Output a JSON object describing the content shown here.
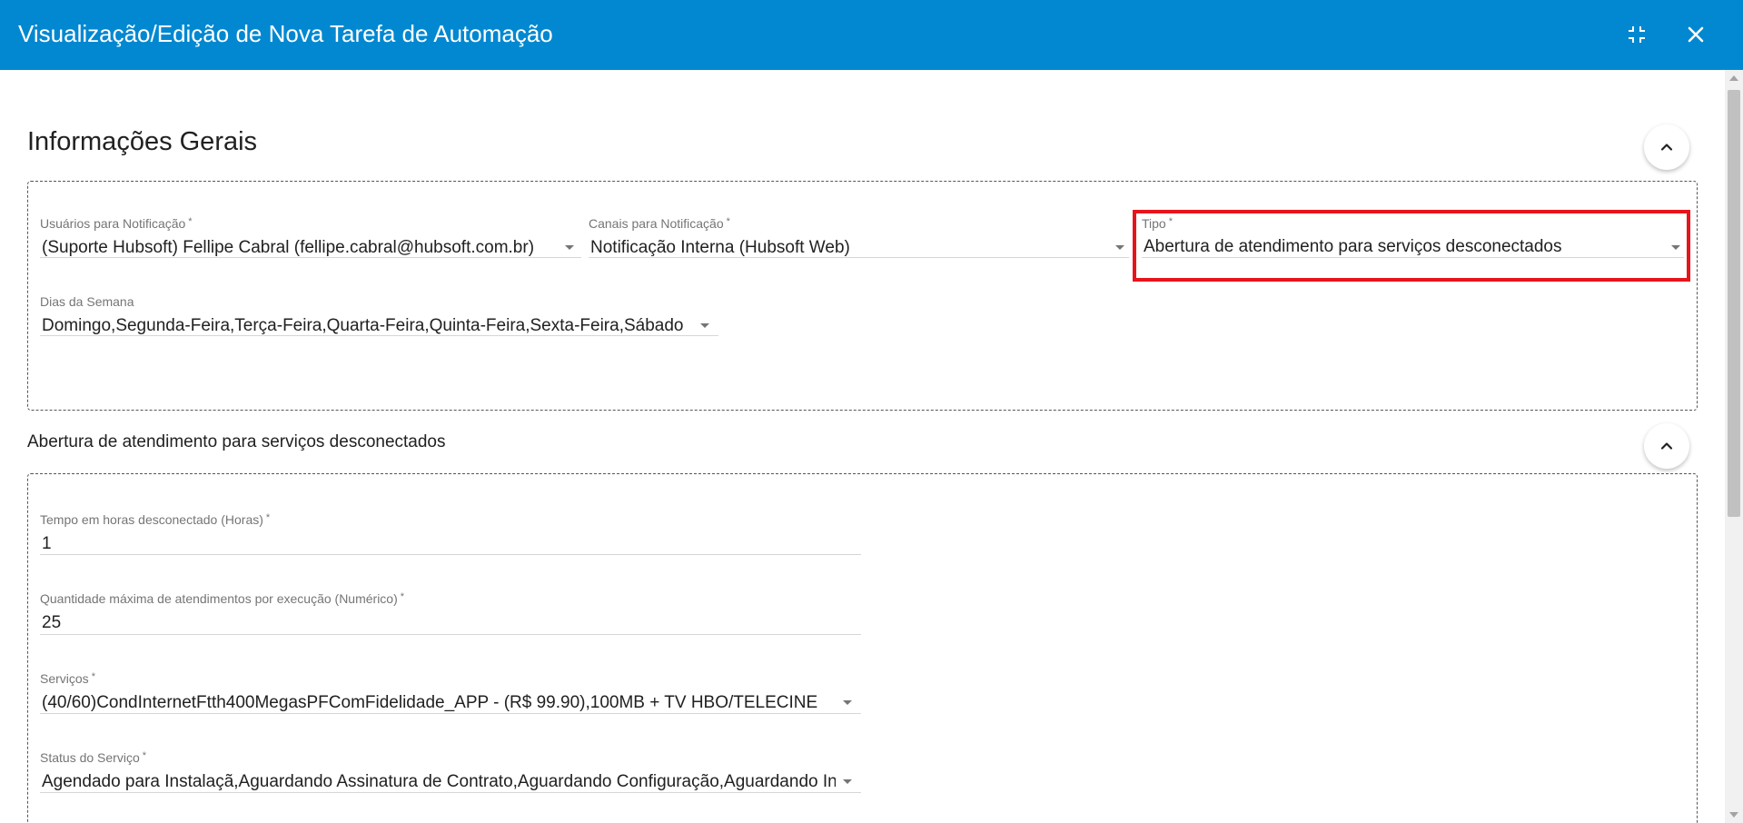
{
  "window": {
    "title": "Visualização/Edição de Nova Tarefa de Automação",
    "minimize_icon": "compress-icon",
    "close_icon": "close-icon"
  },
  "general": {
    "title": "Informações Gerais",
    "fields": {
      "usuarios": {
        "label": "Usuários para Notificação",
        "required": "*",
        "value": "(Suporte Hubsoft) Fellipe Cabral (fellipe.cabral@hubsoft.com.br)"
      },
      "canais": {
        "label": "Canais para Notificação",
        "required": "*",
        "value": "Notificação Interna (Hubsoft Web)"
      },
      "tipo": {
        "label": "Tipo",
        "required": "*",
        "value": "Abertura de atendimento para serviços desconectados"
      },
      "dias": {
        "label": "Dias da Semana",
        "value": "Domingo,Segunda-Feira,Terça-Feira,Quarta-Feira,Quinta-Feira,Sexta-Feira,Sábado"
      }
    }
  },
  "detail": {
    "title": "Abertura de atendimento para serviços desconectados",
    "fields": {
      "tempo": {
        "label": "Tempo em horas desconectado (Horas)",
        "required": "*",
        "value": "1"
      },
      "quantidade": {
        "label": "Quantidade máxima de atendimentos por execução (Numérico)",
        "required": "*",
        "value": "25"
      },
      "servicos": {
        "label": "Serviços",
        "required": "*",
        "value": "(40/60)CondInternetFtth400MegasPFComFidelidade_APP - (R$ 99.90),100MB + TV HBO/TELECINE"
      },
      "status": {
        "label": "Status do Serviço",
        "required": "*",
        "value": "Agendado para Instalaçã,Aguardando Assinatura de Contrato,Aguardando Configuração,Aguardando Instalação"
      }
    }
  },
  "colors": {
    "topbar": "#0288d1",
    "highlight": "#e8141b"
  }
}
